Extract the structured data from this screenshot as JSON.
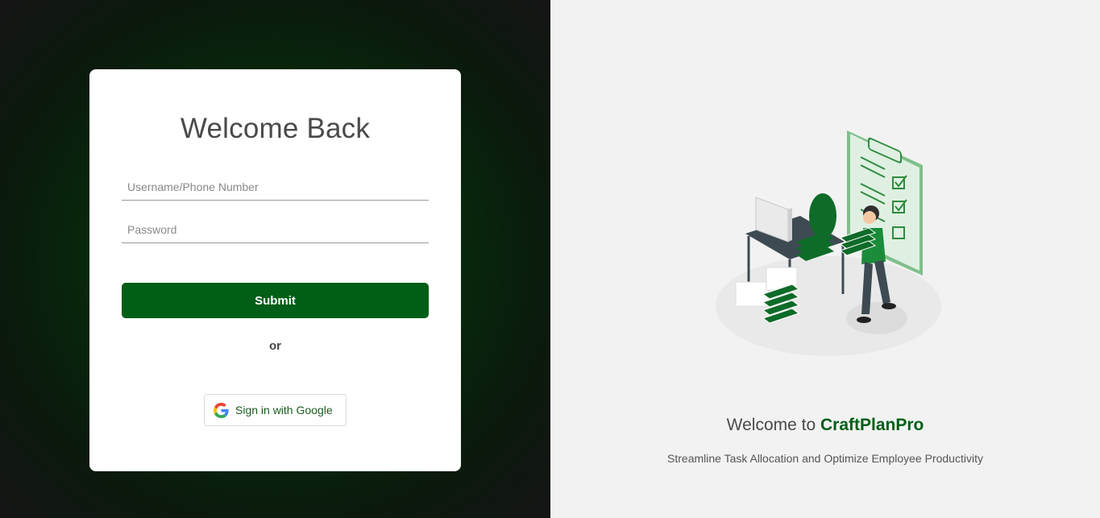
{
  "login": {
    "title": "Welcome Back",
    "username_placeholder": "Username/Phone Number",
    "password_placeholder": "Password",
    "submit_label": "Submit",
    "or_label": "or",
    "google_label": "Sign in with Google"
  },
  "hero": {
    "welcome_prefix": "Welcome to ",
    "brand_name": "CraftPlanPro",
    "tagline": "Streamline Task Allocation and Optimize Employee Productivity"
  },
  "colors": {
    "accent": "#005e16",
    "panel_bg": "#f2f2f2"
  },
  "icons": {
    "google": "google-g-icon",
    "illustration": "task-illustration"
  }
}
